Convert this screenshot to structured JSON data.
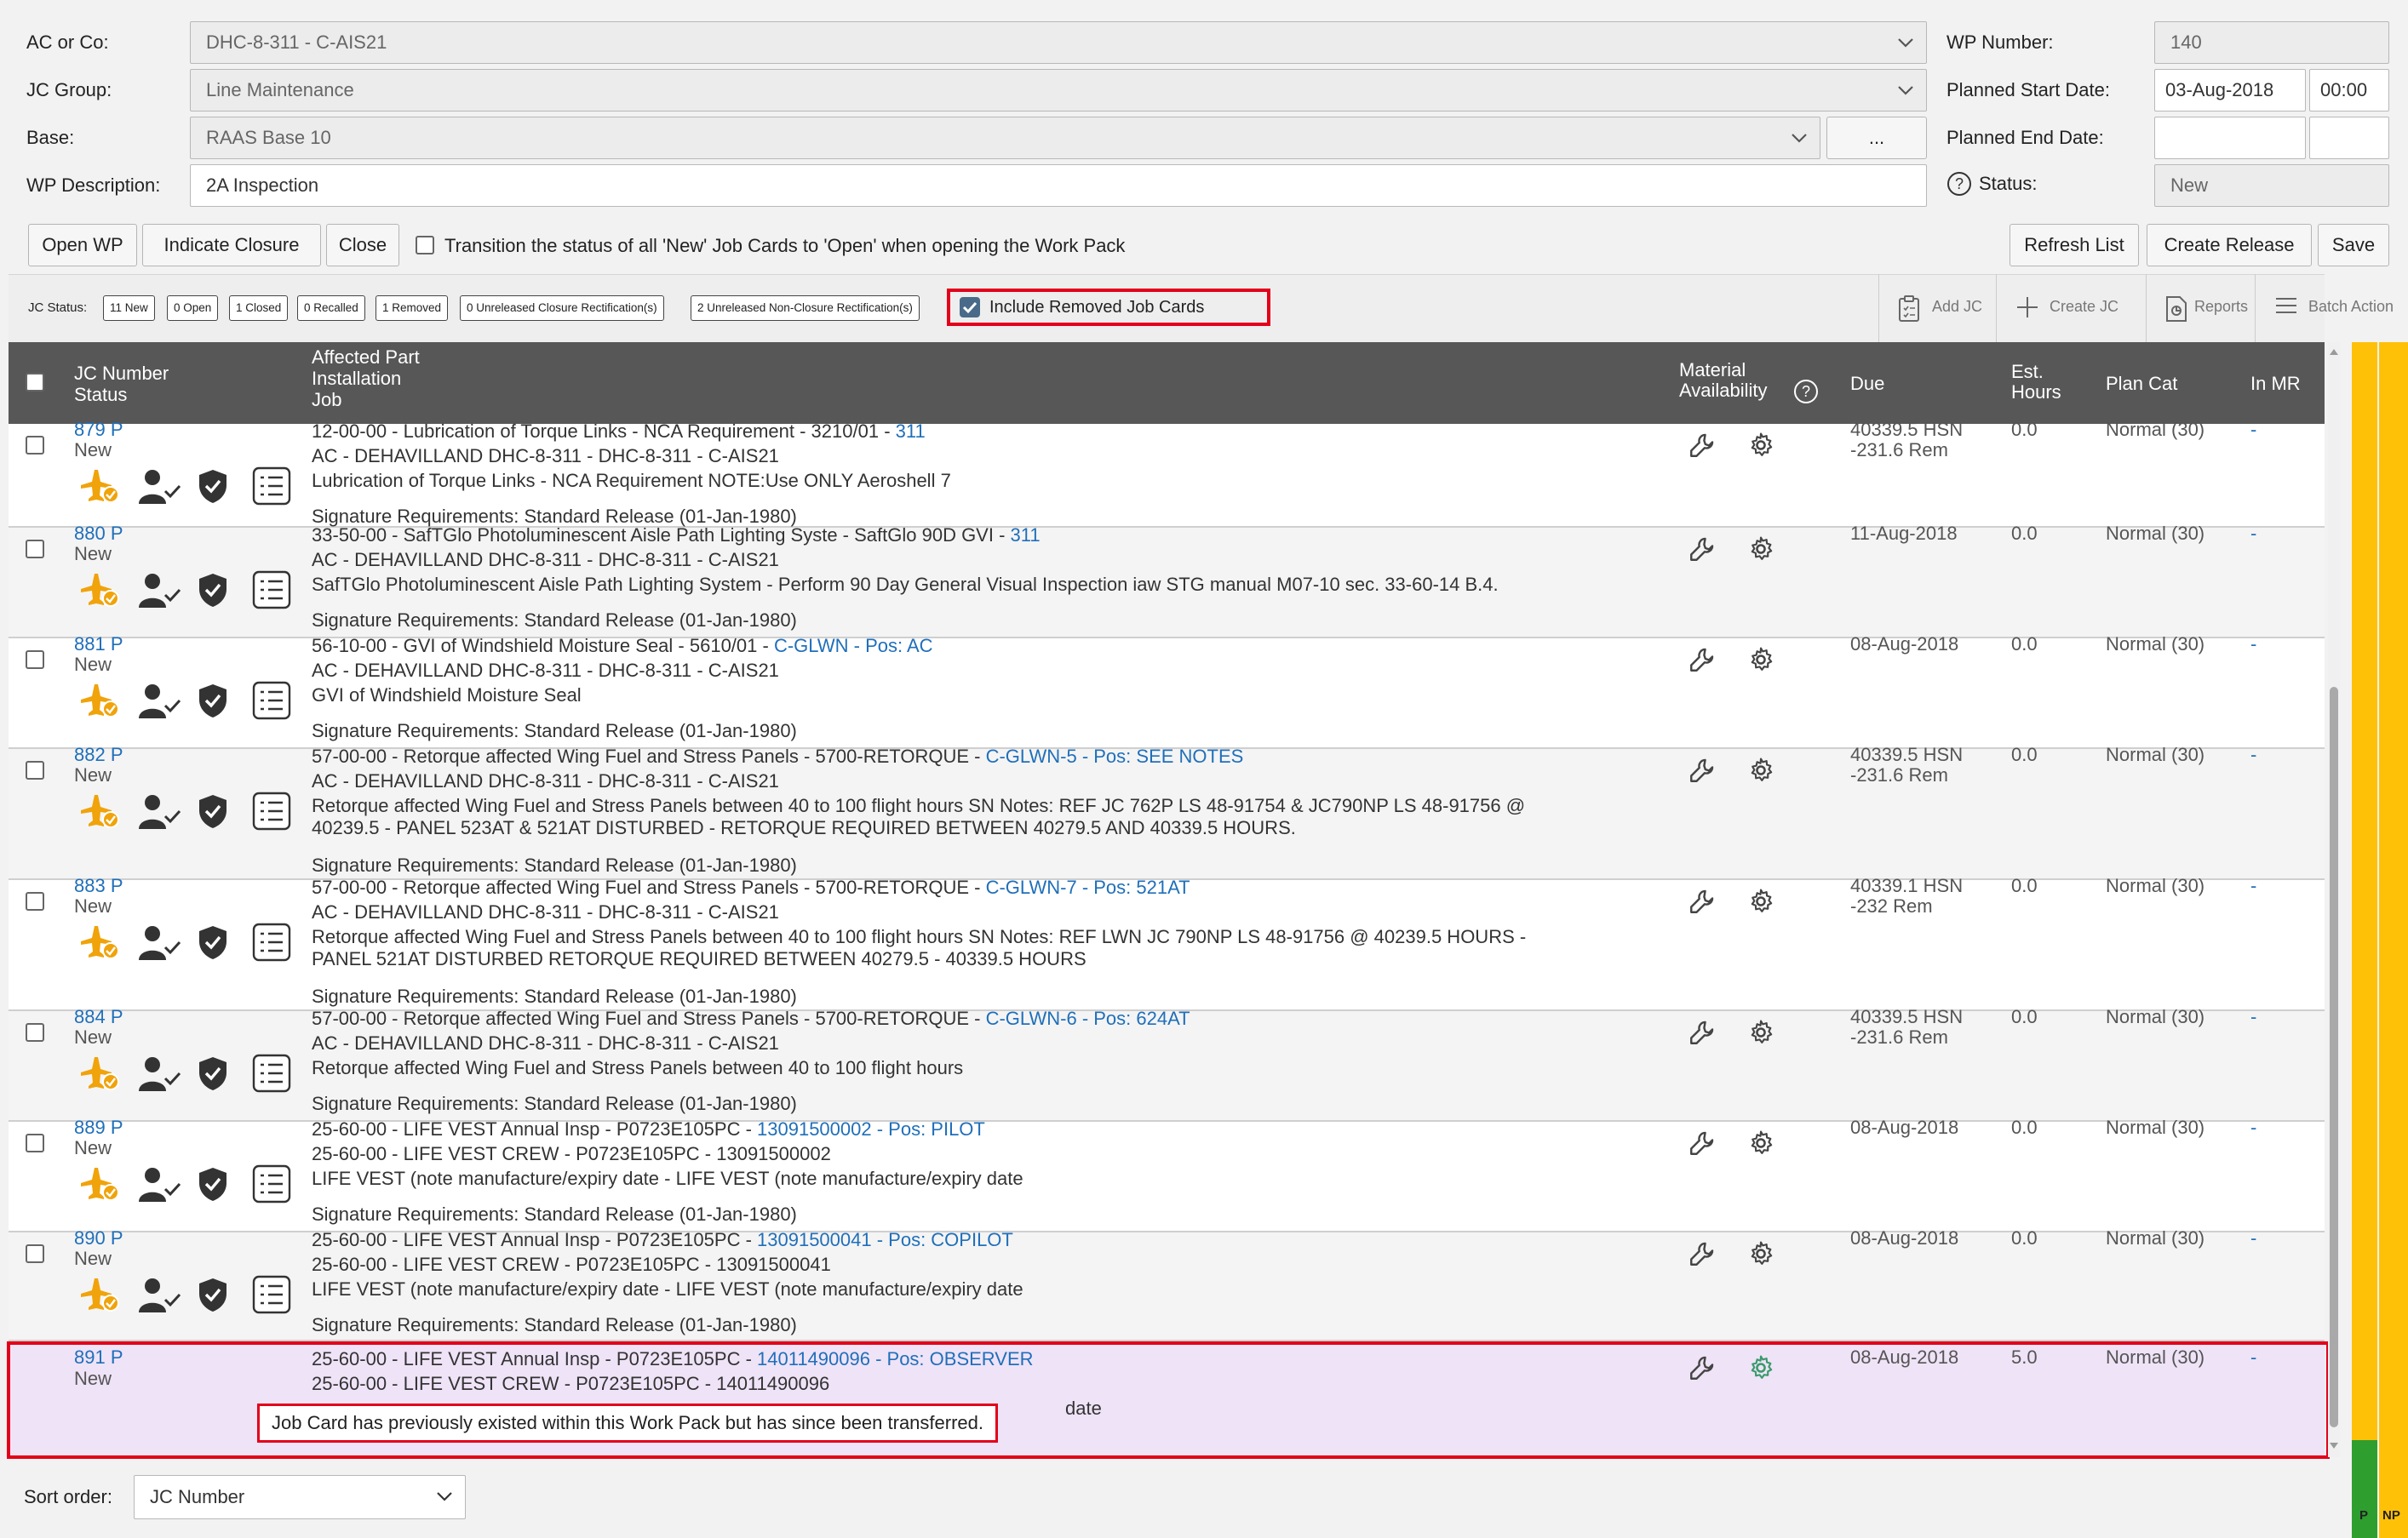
{
  "form": {
    "ac_label": "AC or Co:",
    "ac_value": "DHC-8-311 - C-AIS21",
    "jc_group_label": "JC Group:",
    "jc_group_value": "Line Maintenance",
    "base_label": "Base:",
    "base_value": "RAAS Base 10",
    "base_more": "...",
    "wp_desc_label": "WP Description:",
    "wp_desc_value": "2A Inspection",
    "wp_number_label": "WP Number:",
    "wp_number_value": "140",
    "planned_start_label": "Planned Start Date:",
    "planned_start_date": "03-Aug-2018",
    "planned_start_time": "00:00",
    "planned_end_label": "Planned End Date:",
    "planned_end_date": "",
    "planned_end_time": "",
    "status_label": "Status:",
    "status_value": "New"
  },
  "actions": {
    "open_wp": "Open WP",
    "indicate_closure": "Indicate Closure",
    "close": "Close",
    "transition_text": "Transition the status of all 'New' Job Cards to 'Open' when opening the Work Pack",
    "refresh_list": "Refresh List",
    "create_release": "Create Release",
    "save": "Save"
  },
  "jc_status": {
    "label": "JC Status:",
    "chips": [
      "11 New",
      "0 Open",
      "1 Closed",
      "0 Recalled",
      "1 Removed",
      "0 Unreleased Closure Rectification(s)",
      "2 Unreleased Non-Closure Rectification(s)"
    ],
    "include_removed": "Include Removed Job Cards"
  },
  "toolbar": {
    "add_jc": "Add JC",
    "create_jc": "Create JC",
    "reports": "Reports",
    "batch_action": "Batch Action"
  },
  "table": {
    "h_jc": "JC Number",
    "h_status": "Status",
    "h_affected": "Affected Part",
    "h_installation": "Installation",
    "h_job": "Job",
    "h_material1": "Material",
    "h_material2": "Availability",
    "h_due": "Due",
    "h_est1": "Est.",
    "h_est2": "Hours",
    "h_plancat": "Plan Cat",
    "h_inmr": "In MR",
    "rows": [
      {
        "num": "879 P",
        "status": "New",
        "line1": "12-00-00 - Lubrication of Torque Links - NCA Requirement - 3210/01 - ",
        "link": "311",
        "line2": "AC - DEHAVILLAND DHC-8-311 - DHC-8-311 - C-AIS21",
        "line3": "Lubrication of Torque Links - NCA Requirement NOTE:Use ONLY Aeroshell 7",
        "line4": "",
        "sig": "Signature Requirements: Standard Release (01-Jan-1980)",
        "due1": "40339.5 HSN",
        "due2": "-231.6 Rem",
        "est": "0.0",
        "plan": "Normal (30)",
        "mr": "-"
      },
      {
        "num": "880 P",
        "status": "New",
        "line1": "33-50-00 - SafTGlo Photoluminescent Aisle Path Lighting Syste - SaftGlo 90D GVI - ",
        "link": "311",
        "line2": "AC - DEHAVILLAND DHC-8-311 - DHC-8-311 - C-AIS21",
        "line3": "SafTGlo Photoluminescent Aisle Path Lighting System - Perform 90 Day General Visual Inspection iaw STG manual M07-10 sec. 33-60-14 B.4.",
        "line4": "",
        "sig": "Signature Requirements: Standard Release (01-Jan-1980)",
        "due1": "11-Aug-2018",
        "due2": "",
        "est": "0.0",
        "plan": "Normal (30)",
        "mr": "-"
      },
      {
        "num": "881 P",
        "status": "New",
        "line1": "56-10-00 - GVI of Windshield Moisture Seal - 5610/01 - ",
        "link": "C-GLWN - Pos: AC",
        "line2": "AC - DEHAVILLAND DHC-8-311 - DHC-8-311 - C-AIS21",
        "line3": "GVI of Windshield Moisture Seal",
        "line4": "",
        "sig": "Signature Requirements: Standard Release (01-Jan-1980)",
        "due1": "08-Aug-2018",
        "due2": "",
        "est": "0.0",
        "plan": "Normal (30)",
        "mr": "-"
      },
      {
        "num": "882 P",
        "status": "New",
        "line1": "57-00-00 - Retorque affected Wing Fuel and Stress Panels - 5700-RETORQUE - ",
        "link": "C-GLWN-5 - Pos: SEE NOTES",
        "line2": "AC - DEHAVILLAND DHC-8-311 - DHC-8-311 - C-AIS21",
        "line3": "Retorque affected Wing Fuel and Stress Panels between 40 to 100 flight hours SN Notes: REF JC 762P LS 48-91754 & JC790NP LS 48-91756 @",
        "line4": "40239.5 - PANEL 523AT & 521AT DISTURBED - RETORQUE REQUIRED BETWEEN 40279.5 AND 40339.5 HOURS.",
        "sig": "Signature Requirements: Standard Release (01-Jan-1980)",
        "due1": "40339.5 HSN",
        "due2": "-231.6 Rem",
        "est": "0.0",
        "plan": "Normal (30)",
        "mr": "-"
      },
      {
        "num": "883 P",
        "status": "New",
        "line1": "57-00-00 - Retorque affected Wing Fuel and Stress Panels - 5700-RETORQUE - ",
        "link": "C-GLWN-7 - Pos: 521AT",
        "line2": "AC - DEHAVILLAND DHC-8-311 - DHC-8-311 - C-AIS21",
        "line3": "Retorque affected Wing Fuel and Stress Panels between 40 to 100 flight hours SN Notes: REF LWN JC 790NP LS 48-91756 @ 40239.5 HOURS -",
        "line4": "PANEL 521AT DISTURBED RETORQUE REQUIRED BETWEEN 40279.5 - 40339.5 HOURS",
        "sig": "Signature Requirements: Standard Release (01-Jan-1980)",
        "due1": "40339.1 HSN",
        "due2": "-232 Rem",
        "est": "0.0",
        "plan": "Normal (30)",
        "mr": "-"
      },
      {
        "num": "884 P",
        "status": "New",
        "line1": "57-00-00 - Retorque affected Wing Fuel and Stress Panels - 5700-RETORQUE - ",
        "link": "C-GLWN-6 - Pos: 624AT",
        "line2": "AC - DEHAVILLAND DHC-8-311 - DHC-8-311 - C-AIS21",
        "line3": "Retorque affected Wing Fuel and Stress Panels between 40 to 100 flight hours",
        "line4": "",
        "sig": "Signature Requirements: Standard Release (01-Jan-1980)",
        "due1": "40339.5 HSN",
        "due2": "-231.6 Rem",
        "est": "0.0",
        "plan": "Normal (30)",
        "mr": "-"
      },
      {
        "num": "889 P",
        "status": "New",
        "line1": "25-60-00 - LIFE VEST Annual Insp - P0723E105PC - ",
        "link": "13091500002 - Pos: PILOT",
        "line2": "25-60-00 - LIFE VEST CREW - P0723E105PC - 13091500002",
        "line3": "LIFE VEST (note manufacture/expiry date - LIFE VEST (note manufacture/expiry date",
        "line4": "",
        "sig": "Signature Requirements: Standard Release (01-Jan-1980)",
        "due1": "08-Aug-2018",
        "due2": "",
        "est": "0.0",
        "plan": "Normal (30)",
        "mr": "-"
      },
      {
        "num": "890 P",
        "status": "New",
        "line1": "25-60-00 - LIFE VEST Annual Insp - P0723E105PC - ",
        "link": "13091500041 - Pos: COPILOT",
        "line2": "25-60-00 - LIFE VEST CREW - P0723E105PC - 13091500041",
        "line3": "LIFE VEST (note manufacture/expiry date - LIFE VEST (note manufacture/expiry date",
        "line4": "",
        "sig": "Signature Requirements: Standard Release (01-Jan-1980)",
        "due1": "08-Aug-2018",
        "due2": "",
        "est": "0.0",
        "plan": "Normal (30)",
        "mr": "-"
      }
    ],
    "removed_row": {
      "num": "891 P",
      "status": "New",
      "line1": "25-60-00 - LIFE VEST Annual Insp - P0723E105PC - ",
      "link": "14011490096 - Pos: OBSERVER",
      "line2": "25-60-00 - LIFE VEST CREW - P0723E105PC - 14011490096",
      "line3_tail": "date",
      "due1": "08-Aug-2018",
      "est": "5.0",
      "plan": "Normal (30)",
      "mr": "-",
      "tooltip": "Job Card has previously existed within this Work Pack but has since been transferred."
    }
  },
  "footer": {
    "sort_label": "Sort order:",
    "sort_value": "JC Number"
  },
  "side": {
    "p_label": "P",
    "np_label": "NP"
  },
  "colors": {
    "accent_link": "#1f6fba",
    "header_bg": "#575757",
    "highlight_red": "#e3001b",
    "removed_row_bg": "#efe3f7",
    "warning_icon": "#f0a30a",
    "side_yellow": "#ffc107",
    "side_green": "#2e9e2e"
  }
}
